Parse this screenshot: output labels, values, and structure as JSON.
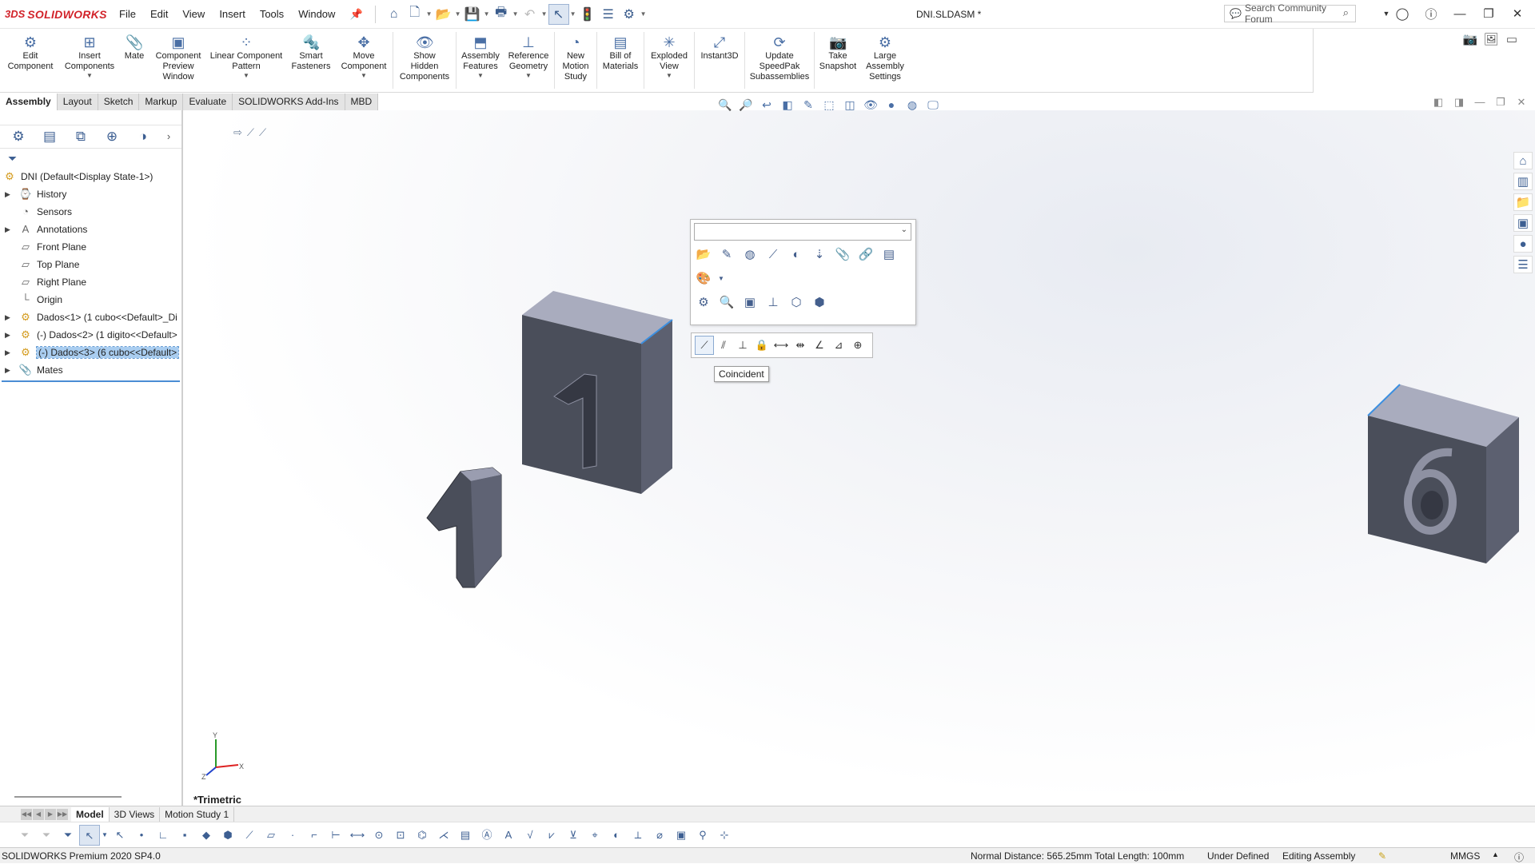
{
  "app": {
    "logo_prefix": "3DS",
    "logo_name": "SOLIDWORKS",
    "title": "DNI.SLDASM *",
    "search_placeholder": "Search Community Forum"
  },
  "menu": [
    "File",
    "Edit",
    "View",
    "Insert",
    "Tools",
    "Window"
  ],
  "commands": [
    {
      "label": "Edit\nComponent",
      "icon": "edit-component-icon",
      "dropdown": false
    },
    {
      "label": "Insert\nComponents",
      "icon": "insert-components-icon",
      "dropdown": true
    },
    {
      "label": "Mate",
      "icon": "mate-icon",
      "dropdown": false
    },
    {
      "label": "Component\nPreview\nWindow",
      "icon": "component-preview-icon",
      "dropdown": false
    },
    {
      "label": "Linear Component\nPattern",
      "icon": "linear-pattern-icon",
      "dropdown": true
    },
    {
      "label": "Smart\nFasteners",
      "icon": "smart-fasteners-icon",
      "dropdown": false
    },
    {
      "label": "Move\nComponent",
      "icon": "move-component-icon",
      "dropdown": true
    },
    {
      "label": "Show\nHidden\nComponents",
      "icon": "show-hidden-icon",
      "dropdown": false
    },
    {
      "label": "Assembly\nFeatures",
      "icon": "assembly-features-icon",
      "dropdown": true
    },
    {
      "label": "Reference\nGeometry",
      "icon": "reference-geometry-icon",
      "dropdown": true
    },
    {
      "label": "New\nMotion\nStudy",
      "icon": "motion-study-icon",
      "dropdown": false
    },
    {
      "label": "Bill of\nMaterials",
      "icon": "bom-icon",
      "dropdown": false
    },
    {
      "label": "Exploded\nView",
      "icon": "exploded-view-icon",
      "dropdown": true
    },
    {
      "label": "Instant3D",
      "icon": "instant3d-icon",
      "dropdown": false
    },
    {
      "label": "Update\nSpeedPak\nSubassemblies",
      "icon": "speedpak-icon",
      "dropdown": false
    },
    {
      "label": "Take\nSnapshot",
      "icon": "snapshot-icon",
      "dropdown": false
    },
    {
      "label": "Large\nAssembly\nSettings",
      "icon": "large-assembly-icon",
      "dropdown": false
    }
  ],
  "tabs": [
    "Assembly",
    "Layout",
    "Sketch",
    "Markup",
    "Evaluate",
    "SOLIDWORKS Add-Ins",
    "MBD"
  ],
  "active_tab": "Assembly",
  "tree": {
    "root": "DNI  (Default<Display State-1>)",
    "items": [
      {
        "label": "History",
        "expand": true,
        "icon": "history-icon"
      },
      {
        "label": "Sensors",
        "expand": false,
        "icon": "sensors-icon"
      },
      {
        "label": "Annotations",
        "expand": true,
        "icon": "annotations-icon"
      },
      {
        "label": "Front Plane",
        "expand": false,
        "icon": "plane-icon"
      },
      {
        "label": "Top Plane",
        "expand": false,
        "icon": "plane-icon"
      },
      {
        "label": "Right Plane",
        "expand": false,
        "icon": "plane-icon"
      },
      {
        "label": "Origin",
        "expand": false,
        "icon": "origin-icon"
      },
      {
        "label": "Dados<1> (1 cubo<<Default>_Di",
        "expand": true,
        "icon": "component-icon"
      },
      {
        "label": "(-) Dados<2> (1 digito<<Default>",
        "expand": true,
        "icon": "component-icon"
      },
      {
        "label": "(-) Dados<3> (6 cubo<<Default>",
        "expand": true,
        "icon": "component-icon",
        "selected": true
      },
      {
        "label": "Mates",
        "expand": true,
        "icon": "mates-icon"
      }
    ]
  },
  "tooltip": "Coincident",
  "view_name": "*Trimetric",
  "bottom_tabs": [
    "Model",
    "3D Views",
    "Motion Study 1"
  ],
  "status": {
    "product": "SOLIDWORKS Premium 2020 SP4.0",
    "measure": "Normal Distance: 565.25mm Total Length: 100mm",
    "definition": "Under Defined",
    "mode": "Editing Assembly",
    "units": "MMGS"
  },
  "model": {
    "cube1_digit": "1",
    "digit_part": "1",
    "cube6_digit": "6"
  },
  "colors": {
    "cube_face_front": "#4a4e5a",
    "cube_face_top": "#a9acbe",
    "cube_face_side": "#5c6070",
    "edge_highlight": "#3b8fe0",
    "brand_red": "#d2232a"
  }
}
